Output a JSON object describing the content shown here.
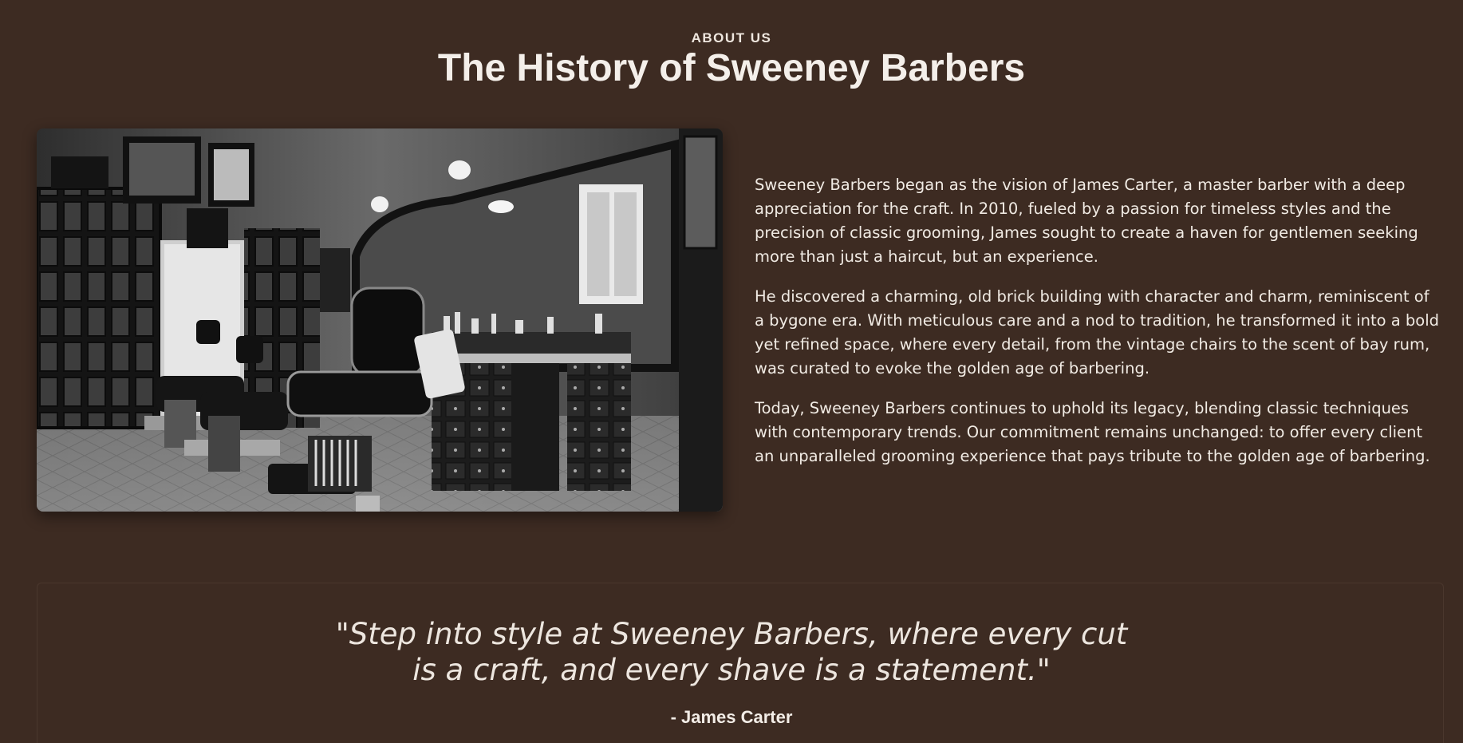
{
  "section": {
    "eyebrow": "ABOUT US",
    "title": "The History of Sweeney Barbers"
  },
  "image": {
    "subject": "barbershop-interior-photo",
    "alt": ""
  },
  "story": {
    "paragraphs": [
      "Sweeney Barbers began as the vision of James Carter, a master barber with a deep appreciation for the craft. In 2010, fueled by a passion for timeless styles and the precision of classic grooming, James sought to create a haven for gentlemen seeking more than just a haircut, but an experience.",
      "He discovered a charming, old brick building with character and charm, reminiscent of a bygone era. With meticulous care and a nod to tradition, he transformed it into a bold yet refined space, where every detail, from the vintage chairs to the scent of bay rum, was curated to evoke the golden age of barbering.",
      "Today, Sweeney Barbers continues to uphold its legacy, blending classic techniques with contemporary trends. Our commitment remains unchanged: to offer every client an unparalleled grooming experience that pays tribute to the golden age of barbering."
    ]
  },
  "testimonial": {
    "quote": "\"Step into style at Sweeney Barbers, where every cut is a craft, and every shave is a statement.\"",
    "author": "- James Carter"
  },
  "colors": {
    "background": "#3d2b22",
    "text": "#f1ebe4"
  }
}
